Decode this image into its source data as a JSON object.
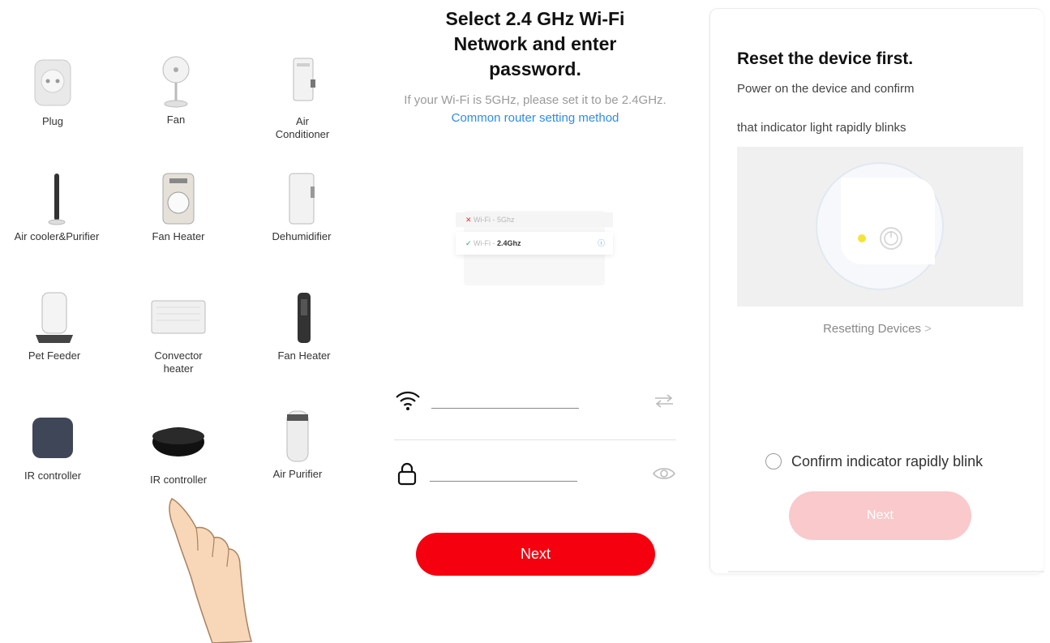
{
  "devices": [
    {
      "label": "Plug"
    },
    {
      "label": "Fan"
    },
    {
      "label": "Air\nConditioner"
    },
    {
      "label": "Air cooler&Purifier"
    },
    {
      "label": "Fan Heater"
    },
    {
      "label": "Dehumidifier"
    },
    {
      "label": "Pet Feeder"
    },
    {
      "label": "Convector\nheater"
    },
    {
      "label": "Fan Heater"
    },
    {
      "label": "IR controller"
    },
    {
      "label": "IR controller"
    },
    {
      "label": "Air Purifier"
    }
  ],
  "wifi": {
    "title": "Select 2.4 GHz Wi-Fi Network and enter password.",
    "hint": "If your Wi-Fi is 5GHz, please set it to be 2.4GHz.",
    "hint_link": "Common router setting method",
    "illus_row1": "Wi-Fi - 5Ghz",
    "illus_row2_prefix": "Wi-Fi - ",
    "illus_row2_band": "2.4Ghz",
    "ssid_value": "",
    "password_value": "",
    "next_label": "Next",
    "accent_color": "#f5000f",
    "link_color": "#2f8ce8"
  },
  "reset": {
    "title": "Reset the device first.",
    "line1": "Power on the device and confirm",
    "line2": "that indicator light rapidly blinks",
    "resetting_link": "Resetting Devices",
    "chevron": ">",
    "confirm_label": "Confirm indicator rapidly blink",
    "confirm_checked": false,
    "next_label": "Next",
    "next_enabled": false,
    "disabled_color": "#f9c9cb",
    "indicator_color": "#f4e43a"
  }
}
